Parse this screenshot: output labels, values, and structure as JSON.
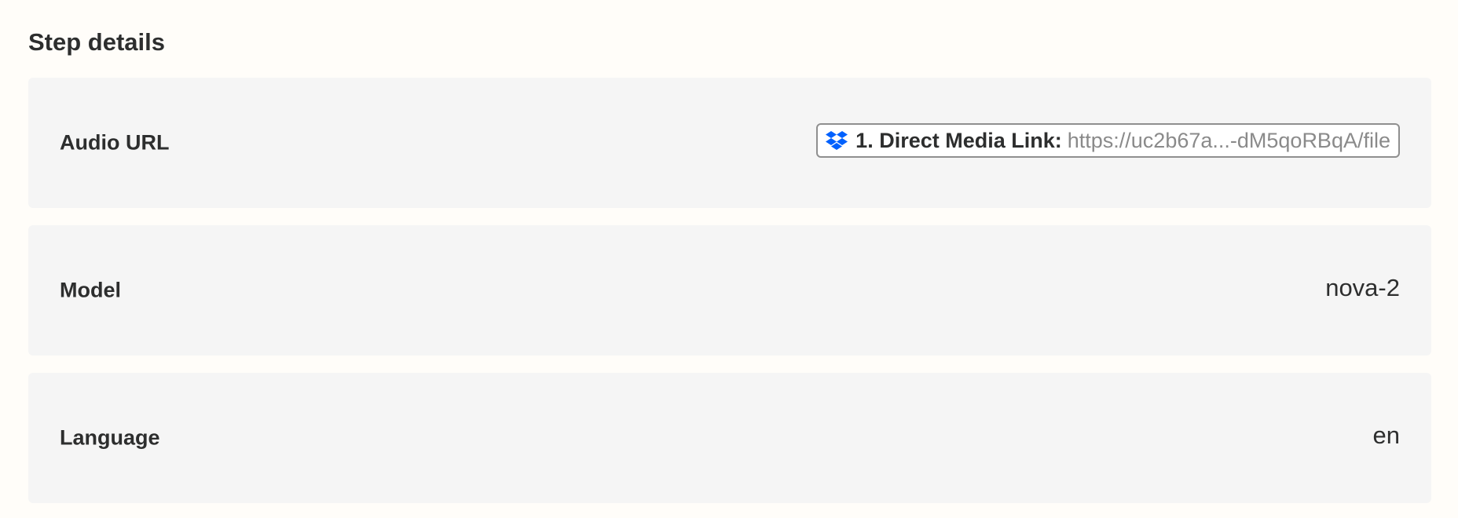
{
  "section": {
    "title": "Step details"
  },
  "fields": [
    {
      "label": "Audio URL",
      "pill": {
        "icon": "dropbox-icon",
        "step_label": "1. Direct Media Link:",
        "value": "https://uc2b67a...-dM5qoRBqA/file"
      }
    },
    {
      "label": "Model",
      "value": "nova-2"
    },
    {
      "label": "Language",
      "value": "en"
    }
  ],
  "colors": {
    "page_background": "#fffdf9",
    "row_background": "#f5f5f5",
    "text": "#2d2e2e",
    "muted_text": "#8a8a8a",
    "dropbox_blue": "#0061fe"
  }
}
